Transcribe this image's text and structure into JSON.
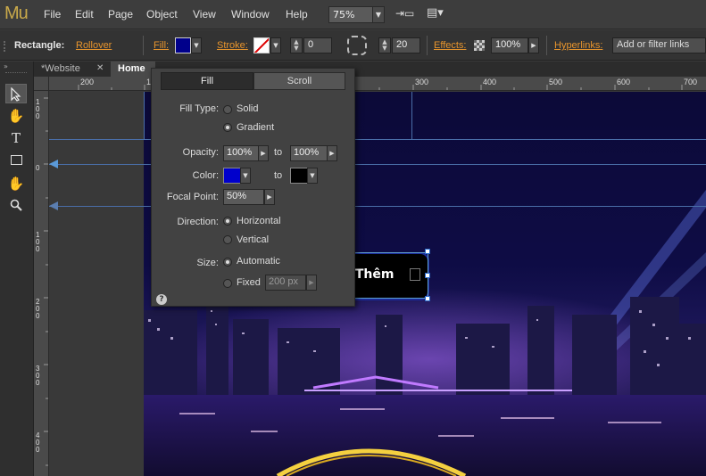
{
  "app": {
    "logo": "Mu"
  },
  "menubar": {
    "items": [
      "File",
      "Edit",
      "Page",
      "Object",
      "View",
      "Window",
      "Help"
    ],
    "zoom": "75%",
    "zoom_arrow": "▼",
    "preview_icon": "⇥▭",
    "view_mode_icon": "▤▾"
  },
  "controlbar": {
    "element_type": "Rectangle:",
    "state": "Rollover",
    "fill_label": "Fill:",
    "fill_color": "#00008b",
    "stroke_label": "Stroke:",
    "stroke_width": "0",
    "corner_radius": "20",
    "effects_label": "Effects:",
    "opacity": "100%",
    "hyperlinks_label": "Hyperlinks:",
    "hyperlinks_placeholder": "Add or filter links"
  },
  "tabs": [
    {
      "label": "*Website",
      "close": "✕"
    },
    {
      "label": "Home"
    }
  ],
  "ruler": {
    "h_labels": [
      "200",
      "1",
      "300",
      "400",
      "500",
      "600",
      "700"
    ],
    "v_labels": [
      "100",
      "0",
      "100",
      "200",
      "300",
      "400"
    ]
  },
  "canvas": {
    "button_text": "u Thêm"
  },
  "fill_panel": {
    "tabs": [
      "Fill",
      "Scroll"
    ],
    "fill_type_label": "Fill Type:",
    "solid_label": "Solid",
    "gradient_label": "Gradient",
    "opacity_label": "Opacity:",
    "opacity_from": "100%",
    "to_label": "to",
    "opacity_to": "100%",
    "color_label": "Color:",
    "color_from": "#0000cc",
    "color_to": "#000000",
    "focal_point_label": "Focal Point:",
    "focal_point": "50%",
    "direction_label": "Direction:",
    "horizontal_label": "Horizontal",
    "vertical_label": "Vertical",
    "size_label": "Size:",
    "automatic_label": "Automatic",
    "fixed_label": "Fixed",
    "fixed_value": "200 px",
    "help_icon": "?"
  },
  "colors": {
    "accent_orange": "#e8952d",
    "logo": "#c9a94a"
  }
}
